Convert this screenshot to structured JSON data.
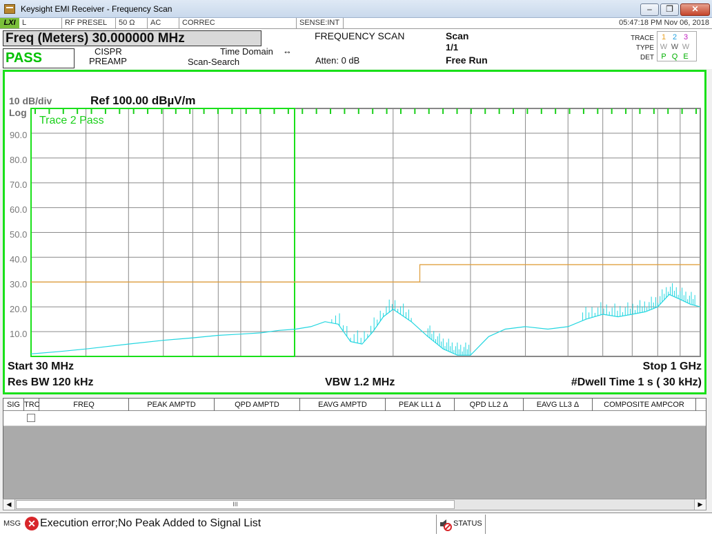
{
  "window": {
    "title": "Keysight EMI Receiver - Frequency Scan",
    "min_glyph": "–",
    "max_glyph": "❐",
    "close_glyph": "✕",
    "icon": "keysight-app-icon"
  },
  "status_strip": {
    "lxi": "LXI",
    "input": "L",
    "rf_presel": "RF PRESEL",
    "impedance": "50 Ω",
    "coupling": "AC",
    "correc": "CORREC",
    "sense": "SENSE:INT",
    "datetime": "05:47:18 PM Nov 06, 2018"
  },
  "header": {
    "freq": "Freq (Meters) 30.000000 MHz",
    "pass": "PASS",
    "cispr": "CISPR",
    "preamp": "PREAMP",
    "time_domain": "Time Domain",
    "scan_search": "Scan-Search",
    "mode": "FREQUENCY SCAN",
    "atten": "Atten: 0 dB",
    "scan": "Scan",
    "scan_count": "1/1",
    "run": "Free Run",
    "trace_label": "TRACE",
    "type_label": "TYPE",
    "det_label": "DET",
    "traces": [
      "1",
      "2",
      "3"
    ],
    "types": [
      "W",
      "W",
      "W"
    ],
    "dets": [
      "P",
      "Q",
      "E"
    ]
  },
  "plot": {
    "scale": "10 dB/div",
    "scale_type": "Log",
    "ref": "Ref 100.00 dBµV/m",
    "y_ticks": [
      "90.0",
      "80.0",
      "70.0",
      "60.0",
      "50.0",
      "40.0",
      "30.0",
      "20.0",
      "10.0"
    ],
    "trace_pass": "Trace 2 Pass",
    "start": "Start 30 MHz",
    "stop": "Stop 1 GHz",
    "rbw": "Res BW 120 kHz",
    "vbw": "VBW 1.2 MHz",
    "dwell": "#Dwell Time 1 s ( 30 kHz)"
  },
  "chart_data": {
    "type": "line",
    "x_scale": "log",
    "x_unit": "MHz",
    "xlim": [
      30,
      1000
    ],
    "ylim": [
      0,
      100
    ],
    "y_unit": "dBµV/m",
    "grid": true,
    "limit_line": [
      {
        "x": 30,
        "y": 30
      },
      {
        "x": 230,
        "y": 30
      },
      {
        "x": 230,
        "y": 37
      },
      {
        "x": 1000,
        "y": 37
      }
    ],
    "series": [
      {
        "color": "#22d6e0",
        "x": [
          30,
          35,
          40,
          50,
          60,
          70,
          80,
          90,
          100,
          110,
          120,
          130,
          140,
          150,
          160,
          170,
          180,
          190,
          200,
          220,
          240,
          260,
          280,
          300,
          330,
          360,
          400,
          450,
          500,
          550,
          600,
          650,
          700,
          750,
          800,
          850,
          900,
          950,
          1000
        ],
        "y": [
          1,
          2,
          3,
          5,
          6.5,
          7.5,
          8.5,
          9,
          9.5,
          10.5,
          11,
          12,
          14,
          13,
          6,
          5,
          10,
          16,
          19,
          14,
          8,
          3,
          0.5,
          0.5,
          8,
          11,
          12,
          11,
          12,
          15,
          17,
          16,
          17,
          18,
          20,
          25,
          23,
          21,
          20
        ]
      }
    ]
  },
  "signal_list": {
    "columns": [
      "SIG",
      "TRC",
      "FREQ",
      "PEAK AMPTD",
      "QPD AMPTD",
      "EAVG AMPTD",
      "PEAK LL1 Δ",
      "QPD LL2 Δ",
      "EAVG LL3 Δ",
      "COMPOSITE AMPCOR"
    ],
    "scroll_grip": "III"
  },
  "message": {
    "label": "MSG",
    "text": "Execution error;No Peak Added to Signal List",
    "status": "STATUS"
  },
  "colors": {
    "pass_green": "#00c000",
    "frame_green": "#19e019",
    "trace_cyan": "#22d6e0",
    "limit_orange": "#e0a040",
    "trace1": "#e8a020",
    "trace2": "#20a0e0",
    "trace3": "#c020c0"
  }
}
